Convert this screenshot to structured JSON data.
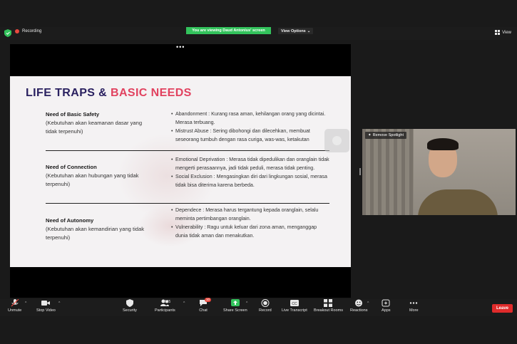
{
  "top": {
    "recording": "Recording",
    "viewing": "You are viewing Daud Antonius' screen",
    "view_options": "View Options",
    "view": "View"
  },
  "slide": {
    "title_a": "LIFE TRAPS & ",
    "title_b": "BASIC NEEDS",
    "needs": [
      {
        "title": "Need of Basic Safety",
        "desc": "(Kebutuhan akan keamanan dasar yang tidak terpenuhi)"
      },
      {
        "title": "Need of Connection",
        "desc": "(Kebutuhan akan hubungan yang tidak terpenuhi)"
      },
      {
        "title": "Need of Autonomy",
        "desc": "(Kebutuhan akan kemandirian yang tidak terpenuhi)"
      }
    ],
    "items": [
      "Abandonment : Kurang rasa aman, kehilangan orang yang dicintai. Merasa terbuang.",
      "Mistrust Abuse : Sering dibohongi dan dilecehkan, membuat seseorang tumbuh dengan rasa curiga, was-was, ketakutan",
      "Emotional Deprivation : Merasa tidak dipedulikan dan oranglain tidak mengerti perasaannya, jadi tidak peduli, merasa tidak penting.",
      "Social Exclusion : Mengasingkan diri dari lingkungan sosial, merasa tidak bisa diterima karena berbeda.",
      "Dependece : Merasa harus tergantung kepada oranglain, selalu meminta pertimbangan oranglain.",
      "Vulnerability : Ragu untuk keluar dari zona aman, menganggap dunia tidak aman dan menakutkan."
    ]
  },
  "video": {
    "remove_spotlight": "Remove Spotlight"
  },
  "toolbar": {
    "unmute": "Unmute",
    "stop_video": "Stop Video",
    "security": "Security",
    "participants": "Participants",
    "participants_count": "135",
    "chat": "Chat",
    "chat_badge": "10",
    "share_screen": "Share Screen",
    "record": "Record",
    "live_transcript": "Live Transcript",
    "breakout_rooms": "Breakout Rooms",
    "reactions": "Reactions",
    "apps": "Apps",
    "more": "More",
    "leave": "Leave"
  },
  "colors": {
    "share_green": "#33c35c",
    "leave_red": "#e02b2b",
    "title_navy": "#2a2160",
    "title_pink": "#e1425f"
  }
}
